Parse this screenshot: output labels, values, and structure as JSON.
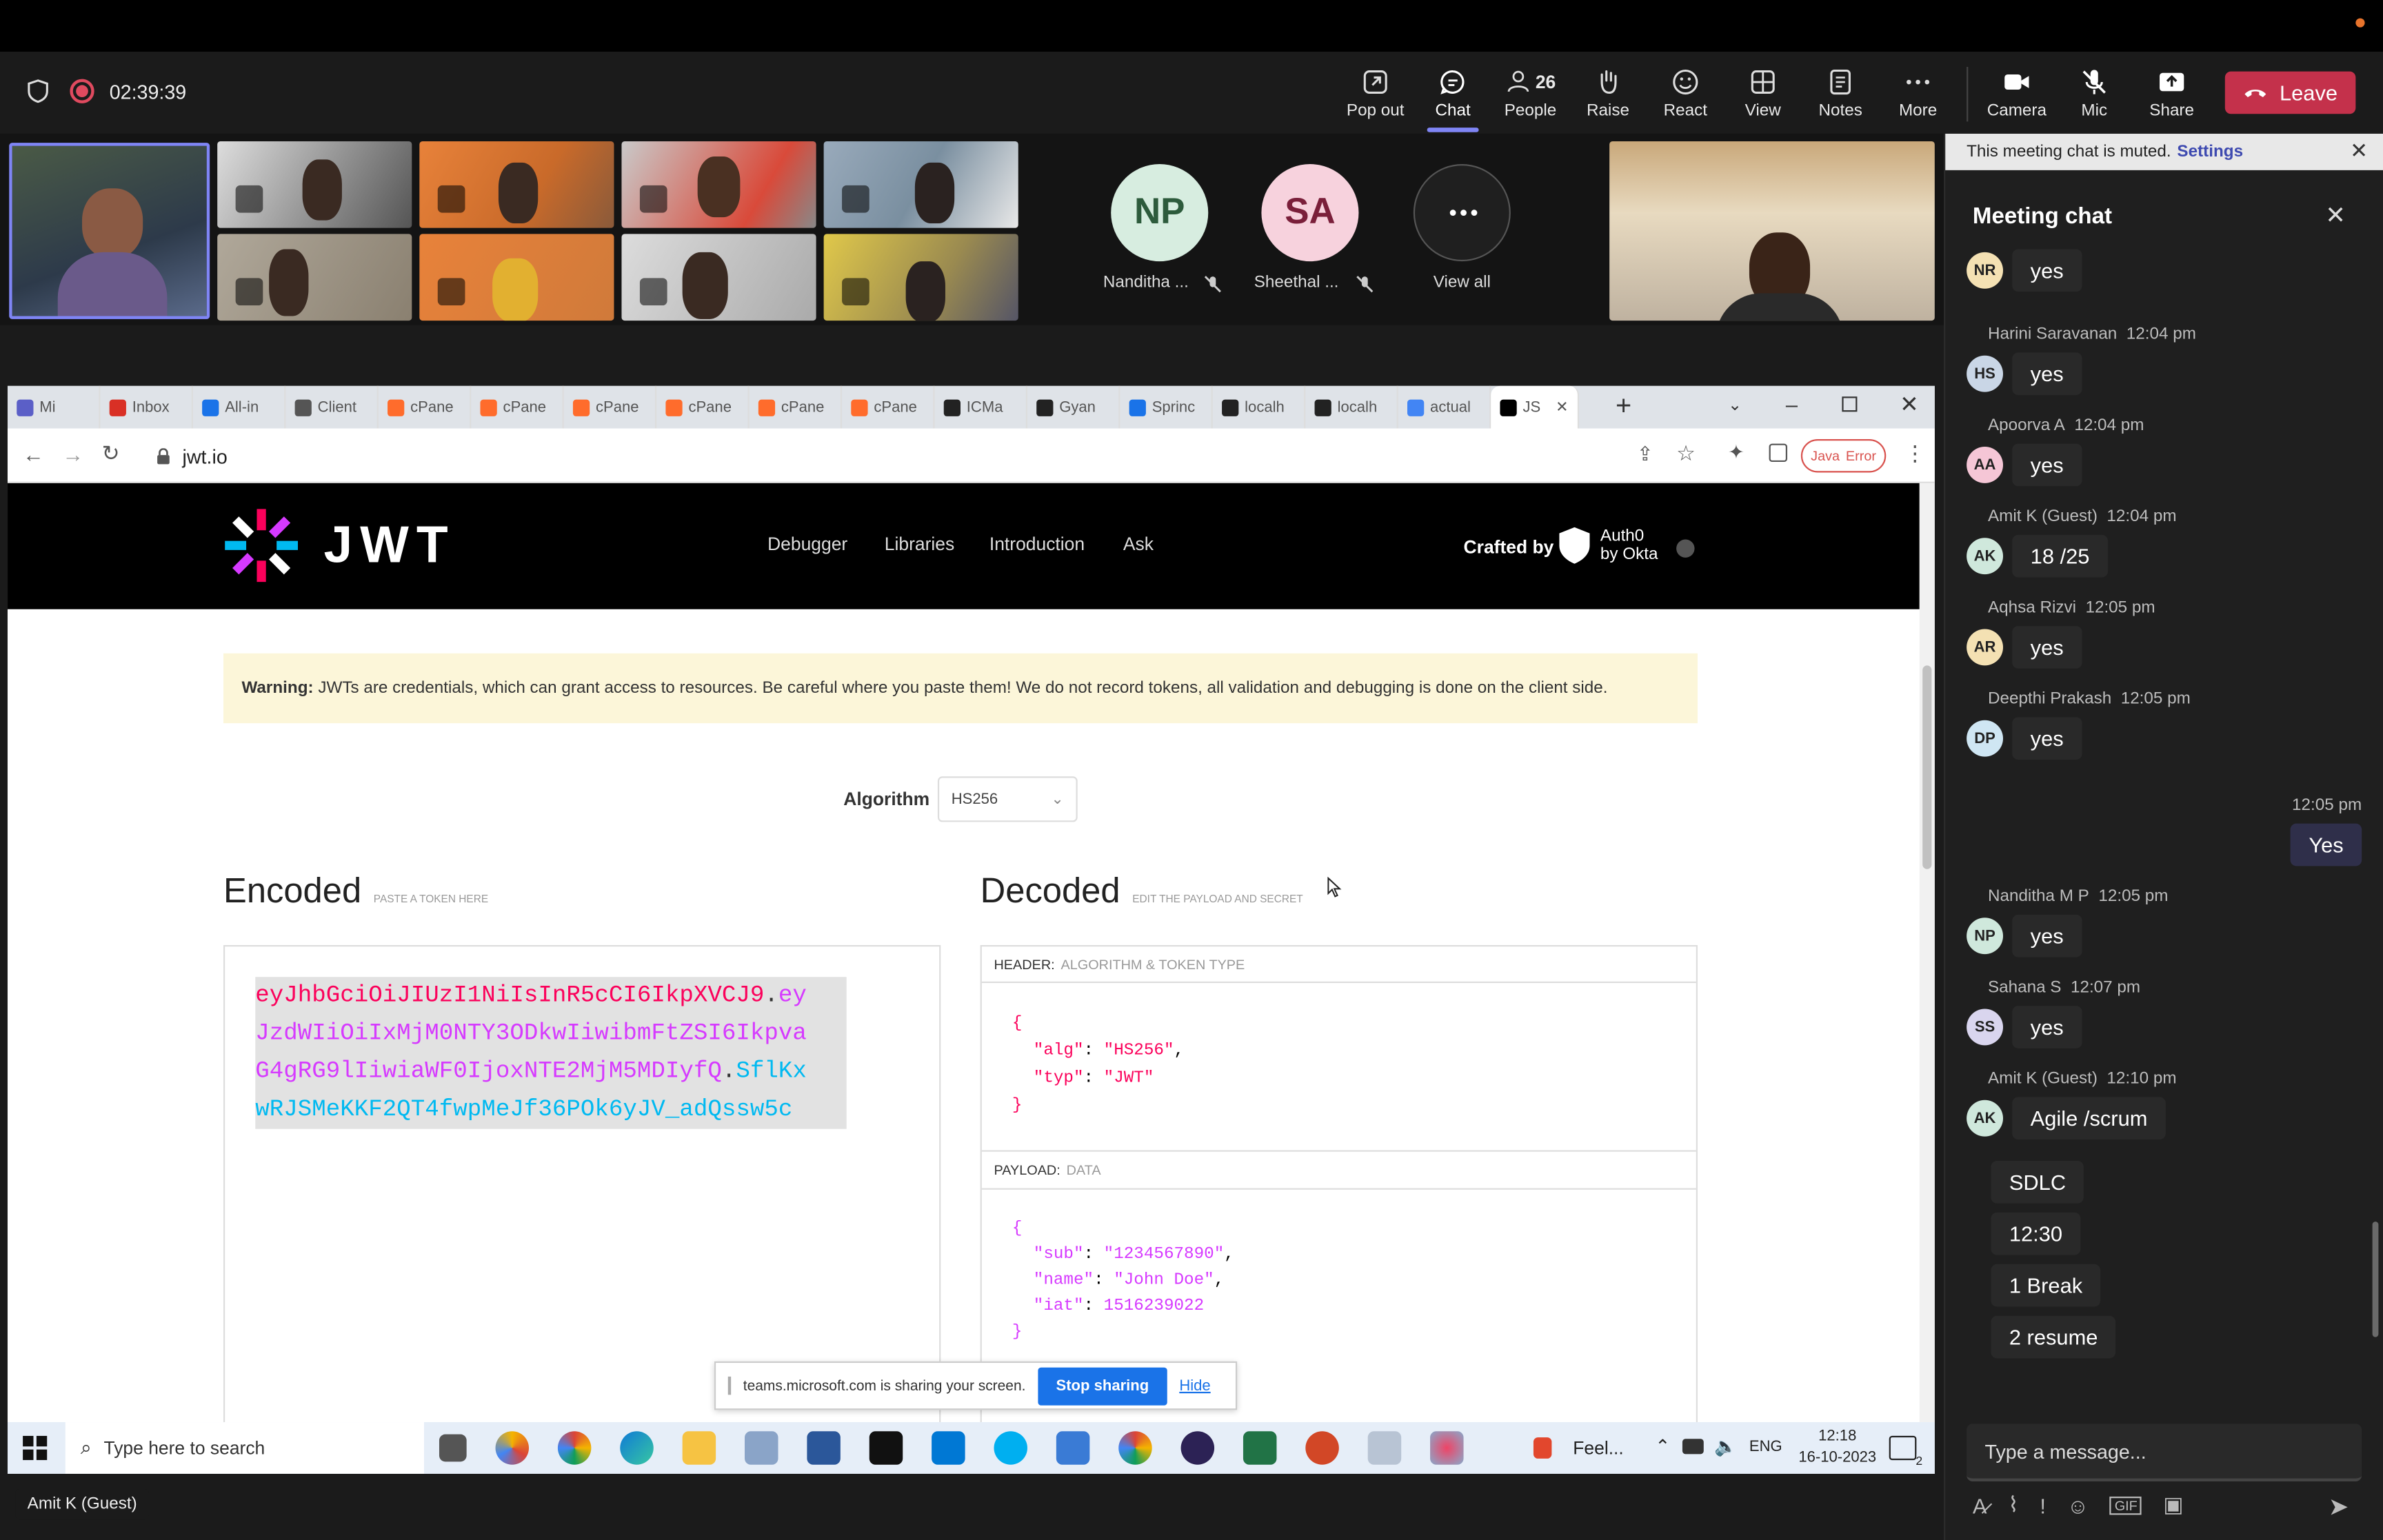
{
  "meeting": {
    "timer": "02:39:39",
    "toolbar": {
      "popout": "Pop out",
      "chat": "Chat",
      "people": "People",
      "people_count": "26",
      "raise": "Raise",
      "react": "React",
      "view": "View",
      "notes": "Notes",
      "more": "More",
      "camera": "Camera",
      "mic": "Mic",
      "share": "Share",
      "leave": "Leave"
    },
    "participants": [
      {
        "initials": "NP",
        "name": "Nanditha ...",
        "color": "#d7ede0",
        "text": "#2d5b3c"
      },
      {
        "initials": "SA",
        "name": "Sheethal ...",
        "color": "#f7d2dd",
        "text": "#7a1f3a"
      }
    ],
    "view_all": "View all",
    "presenter_label": "Amit K (Guest)"
  },
  "chat": {
    "muted_notice": "This meeting chat is muted.",
    "settings_link": "Settings",
    "title": "Meeting chat",
    "messages": [
      {
        "name": "",
        "time": "",
        "initials": "NR",
        "color": "#f4e1b3",
        "text": "yes"
      },
      {
        "name": "Harini Saravanan",
        "time": "12:04 pm",
        "initials": "HS",
        "color": "#c9d6e6",
        "text": "yes"
      },
      {
        "name": "Apoorva A",
        "time": "12:04 pm",
        "initials": "AA",
        "color": "#f5c6d6",
        "text": "yes"
      },
      {
        "name": "Amit K (Guest)",
        "time": "12:04 pm",
        "initials": "AK",
        "color": "#cfe8dc",
        "text": "18 /25"
      },
      {
        "name": "Aqhsa Rizvi",
        "time": "12:05 pm",
        "initials": "AR",
        "color": "#f4e1b3",
        "text": "yes"
      },
      {
        "name": "Deepthi Prakash",
        "time": "12:05 pm",
        "initials": "DP",
        "color": "#cfe6f3",
        "text": "yes"
      }
    ],
    "own_message": {
      "time": "12:05 pm",
      "text": "Yes"
    },
    "messages2": [
      {
        "name": "Nanditha M P",
        "time": "12:05 pm",
        "initials": "NP",
        "color": "#cfe8dc",
        "text": "yes"
      },
      {
        "name": "Sahana S",
        "time": "12:07 pm",
        "initials": "SS",
        "color": "#d9d5ee",
        "text": "yes"
      },
      {
        "name": "Amit K (Guest)",
        "time": "12:10 pm",
        "initials": "AK",
        "color": "#cfe8dc",
        "text": "Agile /scrum"
      }
    ],
    "followups": [
      "SDLC",
      "12:30",
      "1 Break",
      "2 resume"
    ],
    "input_placeholder": "Type a message..."
  },
  "browser": {
    "tabs": [
      {
        "label": "Mi",
        "color": "#5b5fc7"
      },
      {
        "label": "Inbox",
        "color": "#d93025"
      },
      {
        "label": "All-in",
        "color": "#1a73e8"
      },
      {
        "label": "Client",
        "color": "#555555"
      },
      {
        "label": "cPane",
        "color": "#ff6c2c"
      },
      {
        "label": "cPane",
        "color": "#ff6c2c"
      },
      {
        "label": "cPane",
        "color": "#ff6c2c"
      },
      {
        "label": "cPane",
        "color": "#ff6c2c"
      },
      {
        "label": "cPane",
        "color": "#ff6c2c"
      },
      {
        "label": "cPane",
        "color": "#ff6c2c"
      },
      {
        "label": "ICMa",
        "color": "#222222"
      },
      {
        "label": "Gyan",
        "color": "#222222"
      },
      {
        "label": "Sprinc",
        "color": "#1a73e8"
      },
      {
        "label": "localh",
        "color": "#222222"
      },
      {
        "label": "localh",
        "color": "#222222"
      },
      {
        "label": "actual",
        "color": "#4285f4"
      },
      {
        "label": "JS",
        "color": "#000000"
      }
    ],
    "url": "jwt.io",
    "java_error": "Error",
    "java_label": "Java"
  },
  "jwt": {
    "logo_text": "JWT",
    "nav": [
      "Debugger",
      "Libraries",
      "Introduction",
      "Ask"
    ],
    "crafted_by": "Crafted by",
    "auth0": "Auth0",
    "by_okta": "by Okta",
    "warning_bold": "Warning:",
    "warning_text": "JWTs are credentials, which can grant access to resources. Be careful where you paste them! We do not record tokens, all validation and debugging is done on the client side.",
    "algorithm_label": "Algorithm",
    "algorithm_value": "HS256",
    "encoded_title": "Encoded",
    "encoded_hint": "PASTE A TOKEN HERE",
    "decoded_title": "Decoded",
    "decoded_hint": "EDIT THE PAYLOAD AND SECRET",
    "token_lines": [
      {
        "a": "eyJhbGciOiJIUzI1NiIsInR5cCI6IkpXVCJ9",
        "b": ".",
        "c": "ey"
      },
      {
        "a": "",
        "b": "",
        "c": "JzdWIiOiIxMjM0NTY3ODkwIiwibmFtZSI6Ikpva"
      },
      {
        "a": "",
        "b": "",
        "c": "G4gRG9lIiwiaWF0IjoxNTE2MjM5MDIyfQ",
        "d": ".",
        "e": "SflKx"
      },
      {
        "a": "",
        "b": "",
        "e": "wRJSMeKKF2QT4fwpMeJf36POk6yJV_adQssw5c"
      }
    ],
    "header_label": "HEADER:",
    "header_sub": "ALGORITHM & TOKEN TYPE",
    "payload_label": "PAYLOAD:",
    "payload_sub": "DATA",
    "header_json": {
      "alg": "\"HS256\"",
      "typ": "\"JWT\""
    },
    "payload_json": {
      "sub": "\"1234567890\"",
      "name": "\"John Doe\"",
      "iat": "1516239022"
    }
  },
  "share_bar": {
    "text": "teams.microsoft.com is sharing your screen.",
    "stop": "Stop sharing",
    "hide": "Hide"
  },
  "taskbar": {
    "search_placeholder": "Type here to search",
    "weather": "Feel...",
    "lang": "ENG",
    "time": "12:18",
    "date": "16-10-2023",
    "notif_count": "2"
  }
}
